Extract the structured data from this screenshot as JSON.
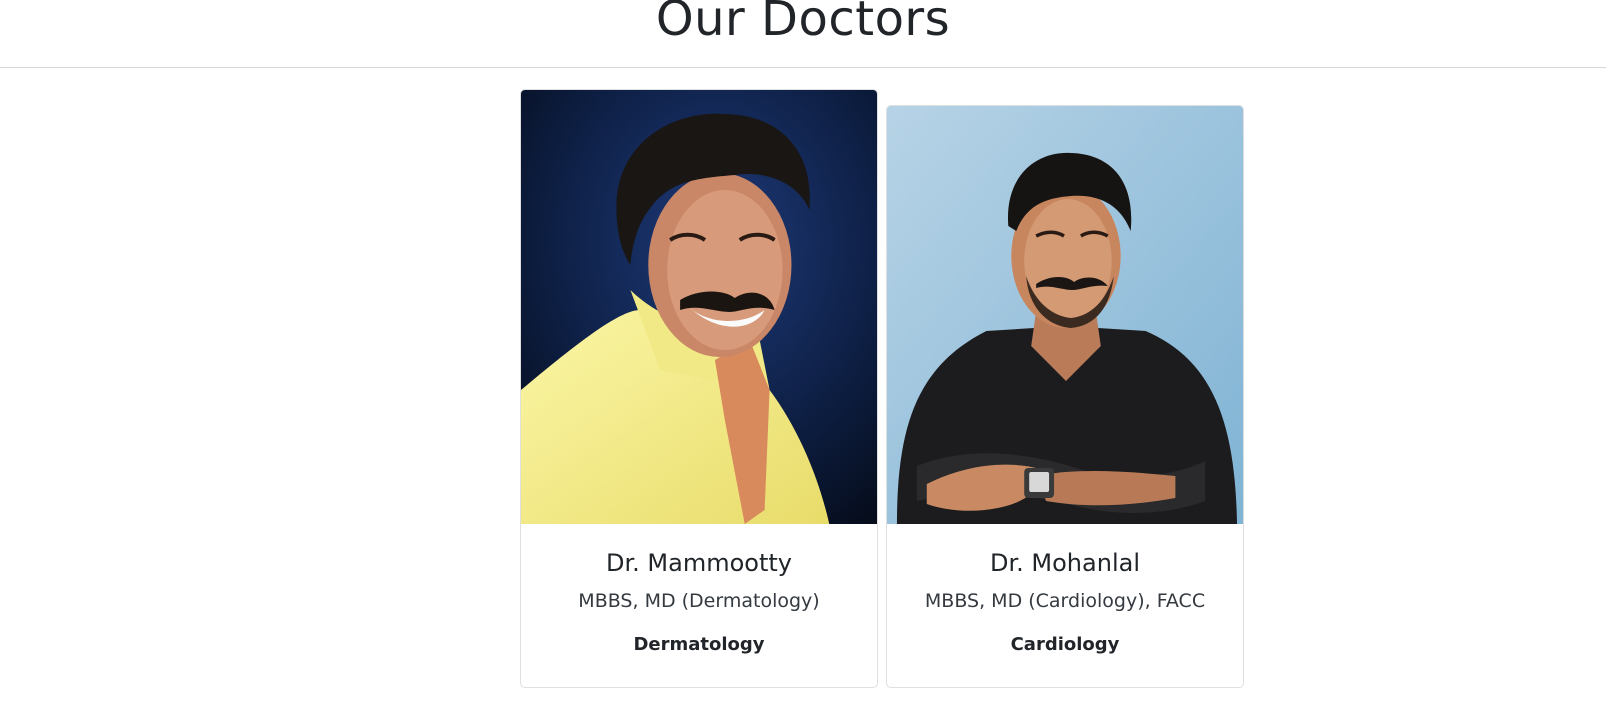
{
  "page": {
    "title": "Our Doctors"
  },
  "doctors": [
    {
      "name": "Dr. Mammootty",
      "qualification": "MBBS, MD (Dermatology)",
      "department": "Dermatology",
      "photo_icon": "doctor-photo"
    },
    {
      "name": "Dr. Mohanlal",
      "qualification": "MBBS, MD (Cardiology), FACC",
      "department": "Cardiology",
      "photo_icon": "doctor-photo"
    }
  ],
  "colors": {
    "text": "#212529",
    "border": "#dfdfdf",
    "photo1_bg": "#0b1a33",
    "photo2_bg": "#8fbcd8"
  }
}
